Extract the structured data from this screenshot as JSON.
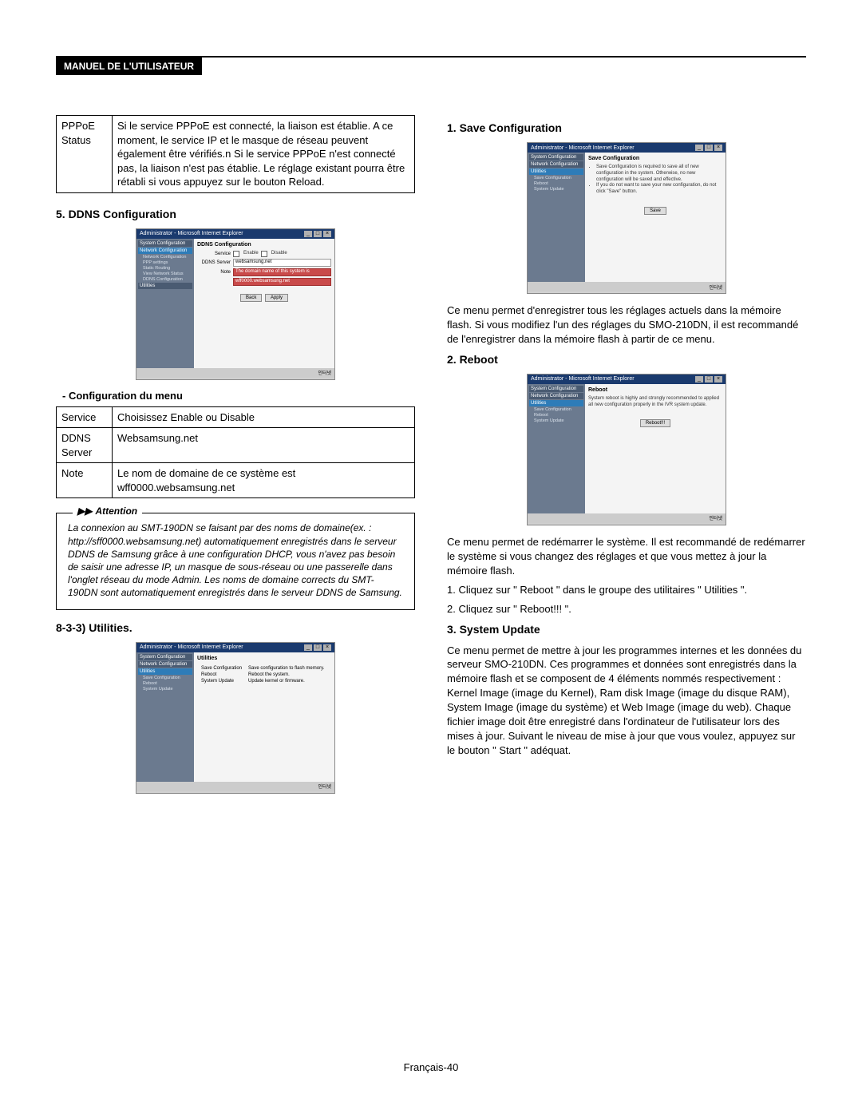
{
  "header": {
    "label": "MANUEL DE L'UTILISATEUR"
  },
  "left": {
    "pppoe_row": {
      "label": "PPPoE Status",
      "desc": "Si le service PPPoE est connecté, la liaison est établie. A ce moment, le service IP et le masque de réseau peuvent également être vérifiés.n Si le service PPPoE n'est connecté pas, la liaison n'est pas établie. Le réglage existant pourra être rétabli si vous appuyez sur le bouton Reload."
    },
    "sec5": "5. DDNS Configuration",
    "ss1": {
      "title": "Administrator - Microsoft Internet Explorer",
      "side": {
        "a": "System Configuration",
        "b": "Network Configuration",
        "subs": [
          "Network Configuration",
          "PPP settings",
          "Static Routing",
          "View Network Status",
          "DDNS Configuration"
        ],
        "c": "Utilities"
      },
      "heading": "DDNS Configuration",
      "service_label": "Service",
      "enable": "Enable",
      "disable": "Disable",
      "server_label": "DDNS Server",
      "server_value": "websamsung.net",
      "note_label": "Note",
      "note1": "The domain name of this system is",
      "note2": "wff0000.websamsung.net",
      "back": "Back",
      "apply": "Apply",
      "status": "인터넷"
    },
    "config_menu": "-   Configuration du menu",
    "tbl": {
      "r1_k": "Service",
      "r1_v": "Choisissez Enable ou Disable",
      "r2_k": "DDNS Server",
      "r2_v": "Websamsung.net",
      "r3_k": "Note",
      "r3_v": "Le nom de domaine de ce système est wff0000.websamsung.net"
    },
    "attention_label": "Attention",
    "attention_text": "La connexion au SMT-190DN se faisant par des noms de domaine(ex. : http://sff0000.websamsung.net) automatiquement enregistrés dans le serveur DDNS de Samsung grâce à une configuration DHCP, vous n'avez pas besoin de saisir une adresse IP, un masque de sous-réseau ou une passerelle dans l'onglet réseau du mode Admin. Les noms de domaine corrects du SMT-190DN sont automatiquement enregistrés dans le serveur DDNS de Samsung.",
    "sec833": "8-3-3) Utilities.",
    "ss2": {
      "title": "Administrator - Microsoft Internet Explorer",
      "side": {
        "a": "System Configuration",
        "b": "Network Configuration",
        "c": "Utilities",
        "subs": [
          "Save Configuration",
          "Reboot",
          "System Update"
        ]
      },
      "heading": "Utilities",
      "r1_k": "Save Configuration",
      "r1_v": "Save configuration to flash memory.",
      "r2_k": "Reboot",
      "r2_v": "Reboot the system.",
      "r3_k": "System Update",
      "r3_v": "Update kernel or firmware.",
      "status": "인터넷"
    }
  },
  "right": {
    "sec1": "1. Save Configuration",
    "ss3": {
      "title": "Administrator - Microsoft Internet Explorer",
      "side": {
        "a": "System Configuration",
        "b": "Network Configuration",
        "c": "Utilities",
        "subs": [
          "Save Configuration",
          "Reboot",
          "System Update"
        ]
      },
      "heading": "Save Configuration",
      "line1": "Save Configuration is required to save all of new configuration in the system. Otherwise, no new configuration will be saved and effective.",
      "line2": "If you do not want to save your new configuration, do not click \"Save\" button.",
      "save": "Save",
      "status": "인터넷"
    },
    "sec1_para": "Ce menu permet d'enregistrer tous les réglages actuels dans la mémoire flash. Si vous modifiez l'un des réglages du SMO-210DN, il est recommandé de l'enregistrer dans la mémoire flash à partir de ce menu.",
    "sec2": "2. Reboot",
    "ss4": {
      "title": "Administrator - Microsoft Internet Explorer",
      "side": {
        "a": "System Configuration",
        "b": "Network Configuration",
        "c": "Utilities",
        "subs": [
          "Save Configuration",
          "Reboot",
          "System Update"
        ]
      },
      "heading": "Reboot",
      "line": "System reboot is highly and strongly recommended to applied all new configuration properly in the IVR system update.",
      "btn": "Reboot!!!",
      "status": "인터넷"
    },
    "sec2_para": "Ce menu permet de redémarrer le système. Il est recommandé de redémarrer le système si vous changez des réglages et que vous mettez à jour la mémoire flash.",
    "sec2_step1": "1. Cliquez sur \" Reboot \" dans le groupe des utilitaires \" Utilities \".",
    "sec2_step2": "2. Cliquez sur \" Reboot!!! \".",
    "sec3": "3. System Update",
    "sec3_para": "Ce menu permet de mettre à jour les programmes internes et les données du serveur SMO-210DN. Ces programmes et données sont enregistrés dans la mémoire flash et se composent de 4 éléments nommés respectivement : Kernel Image (image du Kernel), Ram disk Image (image du disque RAM), System Image (image du système) et Web Image (image du web). Chaque fichier image doit être enregistré dans l'ordinateur de l'utilisateur lors des mises à jour. Suivant le niveau de mise à jour que vous voulez, appuyez sur le bouton \" Start \" adéquat."
  },
  "footer": "Français-40"
}
